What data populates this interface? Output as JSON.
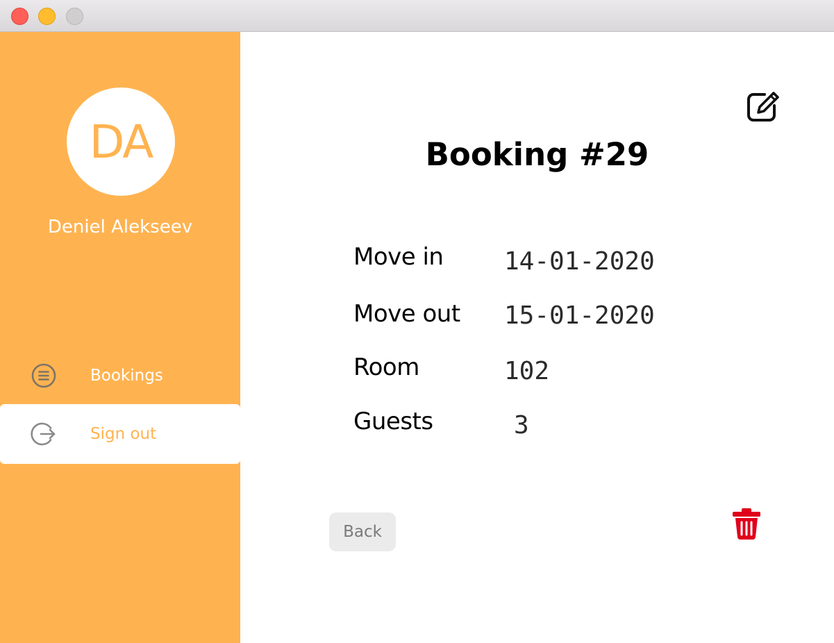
{
  "window": {
    "buttons": [
      "close",
      "minimize",
      "zoom"
    ]
  },
  "sidebar": {
    "avatar_initials": "DA",
    "user_name": "Deniel Alekseev",
    "items": [
      {
        "label": "Bookings",
        "icon": "list-circle-icon",
        "active": false
      },
      {
        "label": "Sign out",
        "icon": "sign-out-icon",
        "active": true
      }
    ]
  },
  "booking": {
    "title": "Booking #29",
    "fields": [
      {
        "label": "Move in",
        "value": "14-01-2020"
      },
      {
        "label": "Move out",
        "value": "15-01-2020"
      },
      {
        "label": "Room",
        "value": "102"
      },
      {
        "label": "Guests",
        "value": "3"
      }
    ]
  },
  "actions": {
    "back_label": "Back",
    "edit_icon": "edit-icon",
    "delete_icon": "trash-icon"
  },
  "colors": {
    "accent": "#ffb350",
    "delete": "#e0001b",
    "back_button_bg": "#ebebeb"
  }
}
